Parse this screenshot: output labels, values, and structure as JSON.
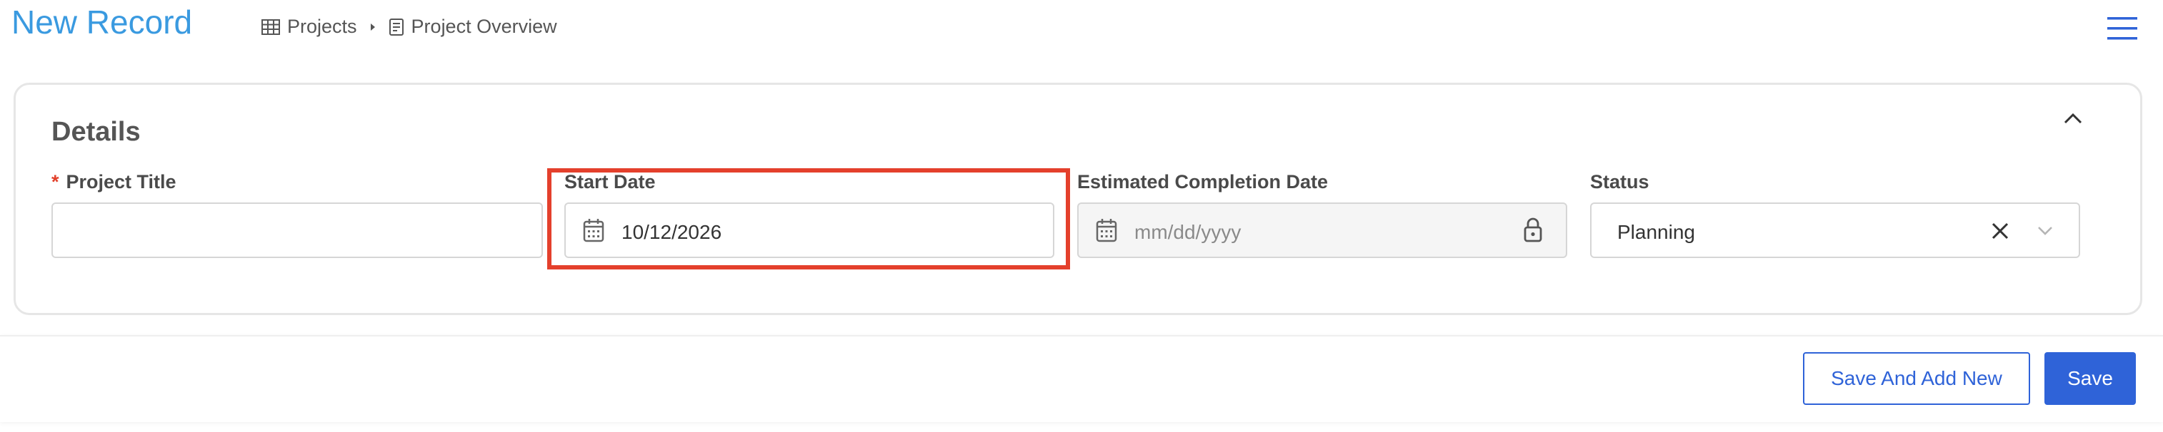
{
  "header": {
    "title": "New Record",
    "breadcrumb": [
      {
        "label": "Projects",
        "icon": "table-icon"
      },
      {
        "label": "Project Overview",
        "icon": "document-icon"
      }
    ],
    "menu_icon": "hamburger-menu-icon"
  },
  "details": {
    "section_title": "Details",
    "collapse_icon": "chevron-up-icon",
    "fields": {
      "project_title": {
        "label": "Project Title",
        "required_marker": "*",
        "value": ""
      },
      "start_date": {
        "label": "Start Date",
        "value": "10/12/2026",
        "icon": "calendar-icon",
        "highlighted": true
      },
      "estimated_completion_date": {
        "label": "Estimated Completion Date",
        "placeholder": "mm/dd/yyyy",
        "icon": "calendar-icon",
        "locked": true
      },
      "status": {
        "label": "Status",
        "value": "Planning"
      }
    }
  },
  "actions": {
    "save_and_add_new": "Save And Add New",
    "save": "Save"
  },
  "colors": {
    "accent": "#2f63d8",
    "title": "#3a9ae0",
    "highlight": "#e4402c",
    "required": "#e2402a"
  }
}
